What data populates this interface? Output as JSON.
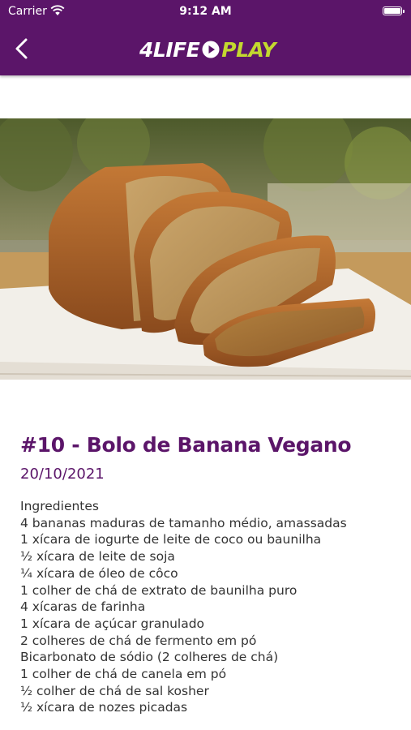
{
  "status_bar": {
    "carrier": "Carrier",
    "time": "9:12 AM"
  },
  "app": {
    "logo_left": "4LIFE",
    "logo_right": "PLAY",
    "brand_color": "#5b1569",
    "accent_color": "#c3d82f"
  },
  "icons": {
    "back": "chevron-left-icon",
    "wifi": "wifi-icon",
    "battery": "battery-icon",
    "play": "play-circle-icon"
  },
  "article": {
    "title": "#10 - Bolo de Banana Vegano",
    "date": "20/10/2021",
    "ingredients_heading": "Ingredientes",
    "ingredients": [
      "4 bananas maduras de tamanho médio, amassadas",
      "1 xícara de iogurte de leite de coco ou baunilha",
      "½ xícara de leite de soja",
      "¼ xícara de óleo de côco",
      "1 colher de chá de extrato de baunilha puro",
      "4 xícaras de farinha",
      "1 xícara de açúcar granulado",
      "2 colheres de chá de fermento em pó",
      "Bicarbonato de sódio (2 colheres de chá)",
      "1 colher de chá de canela em pó",
      "½ colher de chá de sal kosher",
      "½ xícara de nozes picadas"
    ]
  }
}
